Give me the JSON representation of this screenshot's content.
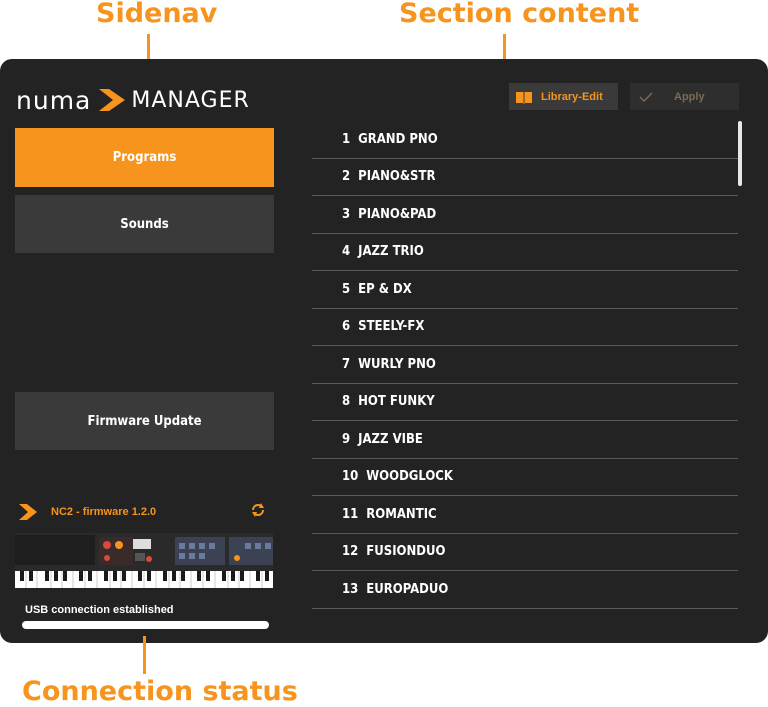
{
  "annotations": {
    "sidenav": "Sidenav",
    "section_content": "Section content",
    "connection_status": "Connection status"
  },
  "logo": {
    "left": "numa",
    "right": "MANAGER"
  },
  "sidebar": {
    "items": [
      {
        "label": "Programs",
        "active": true
      },
      {
        "label": "Sounds",
        "active": false
      }
    ],
    "firmware_update": "Firmware Update"
  },
  "device": {
    "name": "NC2 - firmware 1.2.0"
  },
  "connection": {
    "status": "USB connection established",
    "progress": 1.0
  },
  "toolbar": {
    "library_edit": "Library-Edit",
    "apply": "Apply"
  },
  "programs": [
    {
      "num": "1",
      "name": "GRAND PNO"
    },
    {
      "num": "2",
      "name": "PIANO&STR"
    },
    {
      "num": "3",
      "name": "PIANO&PAD"
    },
    {
      "num": "4",
      "name": "JAZZ TRIO"
    },
    {
      "num": "5",
      "name": "EP & DX"
    },
    {
      "num": "6",
      "name": "STEELY-FX"
    },
    {
      "num": "7",
      "name": "WURLY PNO"
    },
    {
      "num": "8",
      "name": "HOT FUNKY"
    },
    {
      "num": "9",
      "name": "JAZZ VIBE"
    },
    {
      "num": "10",
      "name": "WOODGLOCK"
    },
    {
      "num": "11",
      "name": "ROMANTIC"
    },
    {
      "num": "12",
      "name": "FUSIONDUO"
    },
    {
      "num": "13",
      "name": "EUROPADUO"
    }
  ],
  "colors": {
    "accent": "#f7941d",
    "window": "#232323",
    "button": "#3a3a3a"
  }
}
